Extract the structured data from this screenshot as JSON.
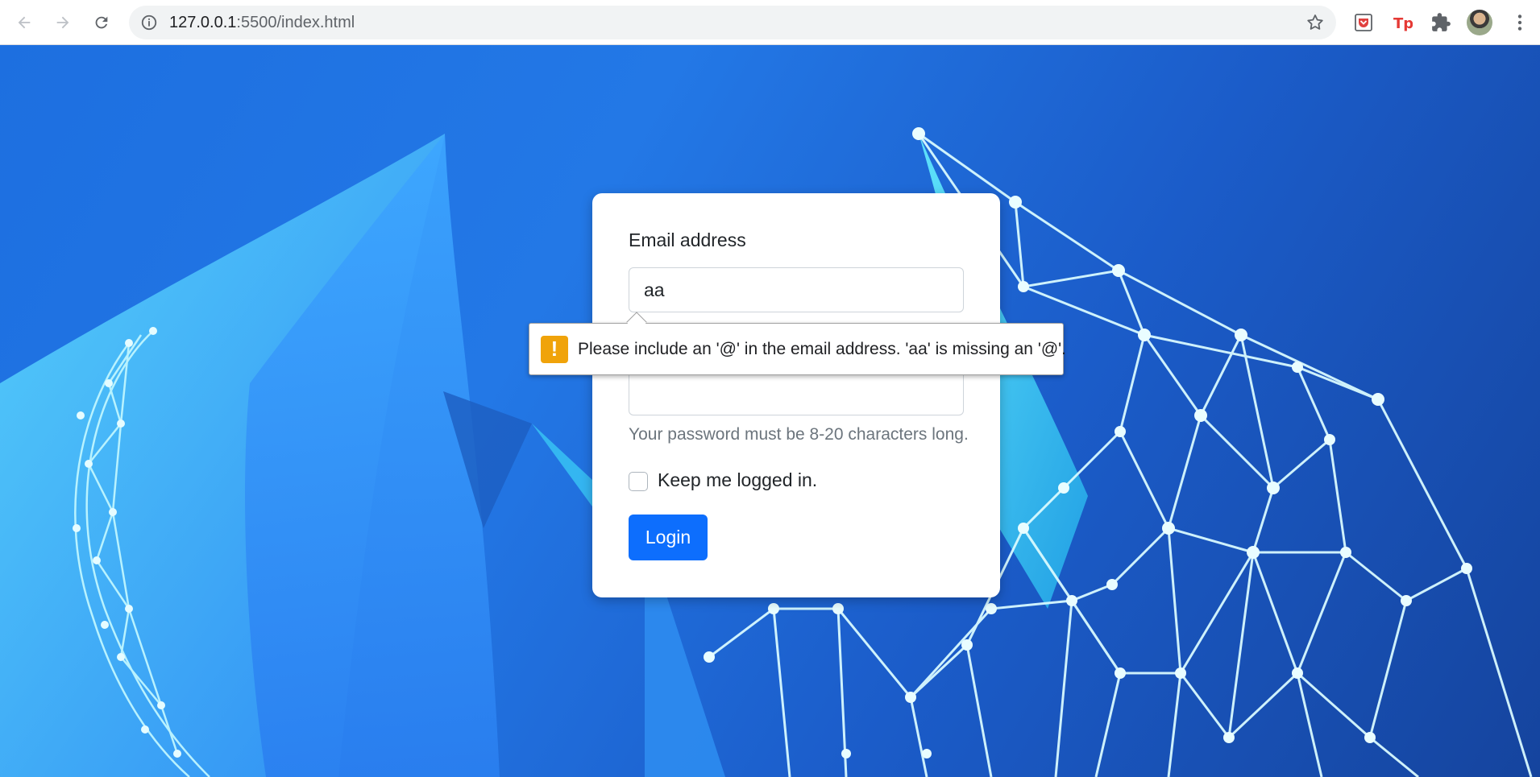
{
  "browser": {
    "url_host": "127.0.0.1",
    "url_rest": ":5500/index.html",
    "nav": {
      "back": "back-arrow-icon",
      "forward": "forward-arrow-icon",
      "reload": "reload-icon"
    },
    "extensions": [
      "pocket-icon",
      "tp-extension-icon",
      "puzzle-extensions-icon"
    ],
    "colors": {
      "chrome_bg": "#ffffff",
      "omnibox_bg": "#f1f3f4"
    }
  },
  "form": {
    "email_label": "Email address",
    "email_value": "aa",
    "password_help": "Your password must be 8-20 characters long.",
    "remember_label": "Keep me logged in.",
    "login_button": "Login",
    "remember_checked": false
  },
  "validation": {
    "icon": "!",
    "message": "Please include an '@' in the email address. 'aa' is missing an '@'."
  },
  "colors": {
    "primary": "#0d6efd",
    "warning": "#f0a30a",
    "background": "#1d6fe0"
  }
}
